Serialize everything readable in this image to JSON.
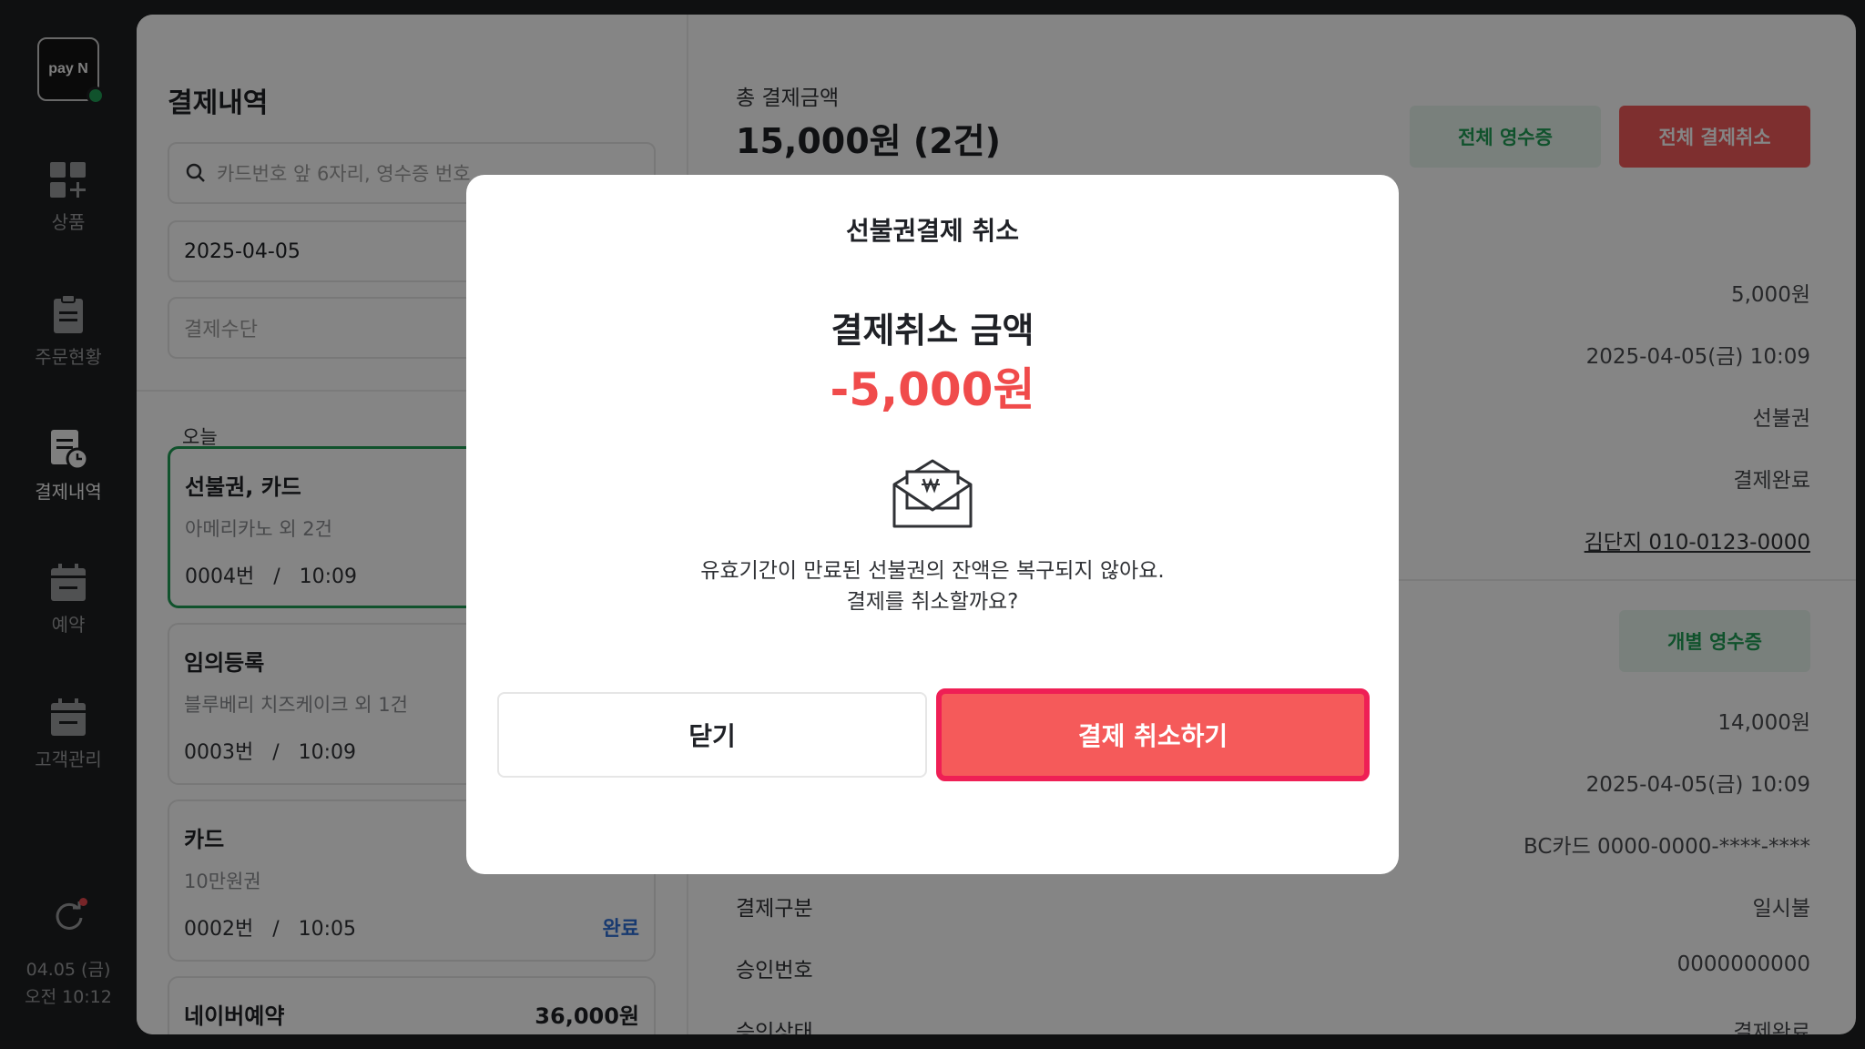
{
  "app": {
    "logo_text": "pay N"
  },
  "nav": [
    {
      "label": "상품",
      "icon": "product-grid-icon"
    },
    {
      "label": "주문현황",
      "icon": "clipboard-icon"
    },
    {
      "label": "결제내역",
      "icon": "receipt-clock-icon",
      "active": true
    },
    {
      "label": "예약",
      "icon": "calendar-icon"
    },
    {
      "label": "고객관리",
      "icon": "calendar-customer-icon"
    }
  ],
  "clock": {
    "date": "04.05 (금)",
    "time": "오전 10:12"
  },
  "list_panel": {
    "title": "결제내역",
    "search_placeholder": "카드번호 앞 6자리, 영수증 번호",
    "date_value": "2025-04-05",
    "method_placeholder": "결제수단",
    "day_label": "오늘",
    "transactions": [
      {
        "title": "선불권, 카드",
        "subtitle": "아메리카노 외 2건",
        "number": "0004번",
        "time": "10:09"
      },
      {
        "title": "임의등록",
        "subtitle": "블루베리 치즈케이크 외 1건",
        "number": "0003번",
        "time": "10:09"
      },
      {
        "title": "카드",
        "subtitle": "10만원권",
        "number": "0002번",
        "time": "10:05",
        "status": "완료"
      },
      {
        "title": "네이버예약",
        "amount": "36,000원"
      }
    ],
    "meta_sep": "/"
  },
  "detail": {
    "total_label": "총 결제금액",
    "total_value": "15,000원 (2건)",
    "all_receipt_label": "전체 영수증",
    "all_cancel_label": "전체 결제취소",
    "section1_values": [
      "5,000원",
      "2025-04-05(금) 10:09",
      "선불권",
      "결제완료",
      "김단지 010-0123-0000"
    ],
    "indiv_receipt_label": "개별 영수증",
    "section2_values": [
      "14,000원",
      "2025-04-05(금) 10:09",
      "BC카드 0000-0000-****-****"
    ],
    "rows": [
      {
        "label": "결제구분",
        "value": "일시불"
      },
      {
        "label": "승인번호",
        "value": "0000000000"
      },
      {
        "label": "승인상태",
        "value": "결제완료"
      }
    ]
  },
  "modal": {
    "title": "선불권결제 취소",
    "heading": "결제취소 금액",
    "amount": "-5,000원",
    "icon": "envelope-won-icon",
    "message_line1": "유효기간이 만료된 선불권의 잔액은 복구되지 않아요.",
    "message_line2": "결제를 취소할까요?",
    "close_label": "닫기",
    "confirm_label": "결제 취소하기"
  },
  "colors": {
    "accent_green": "#1f9d55",
    "danger": "#f04b4b",
    "confirm_border": "#ef1f55",
    "rail_bg": "#1e1f21"
  }
}
